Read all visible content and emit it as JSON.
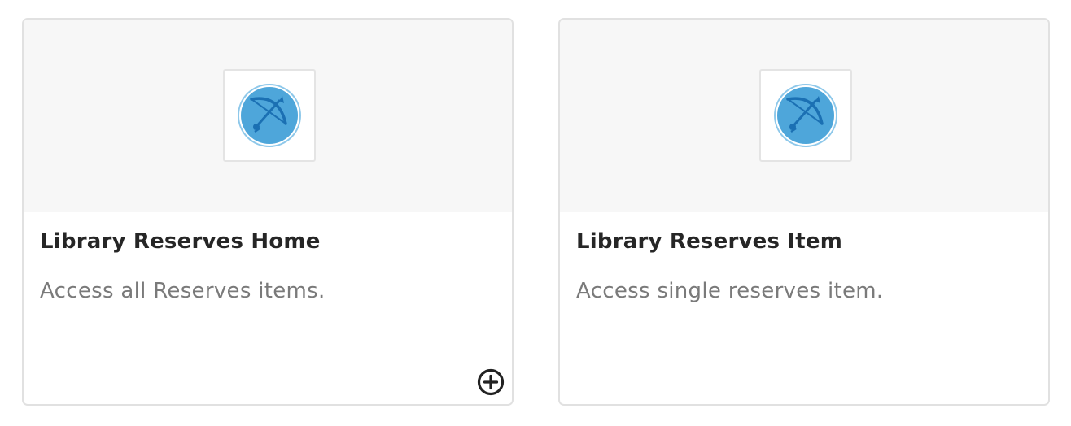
{
  "cards": [
    {
      "title": "Library Reserves Home",
      "description": "Access all Reserves items.",
      "icon": "bow-arrow-icon",
      "has_add_button": true
    },
    {
      "title": "Library Reserves Item",
      "description": "Access single reserves item.",
      "icon": "bow-arrow-icon",
      "has_add_button": false
    }
  ],
  "colors": {
    "icon_circle": "#4ea6da",
    "icon_ring": "#8ec8ea",
    "icon_line": "#1b70b3",
    "card_header_bg": "#f7f7f7",
    "card_border": "#e1e1e1",
    "title_text": "#262626",
    "description_text": "#7a7a7a",
    "add_icon": "#222222"
  }
}
